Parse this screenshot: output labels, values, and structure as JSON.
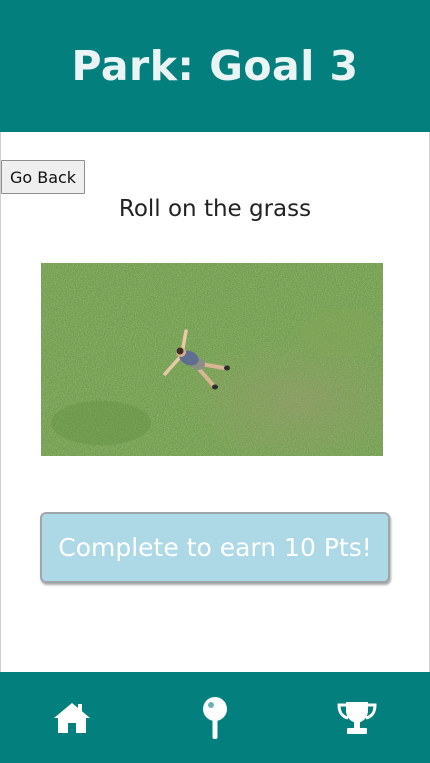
{
  "header": {
    "title": "Park: Goal 3"
  },
  "back_button": {
    "label": "Go Back"
  },
  "goal": {
    "description": "Roll on the grass",
    "image_icon": "grass-photo"
  },
  "complete_button": {
    "label": "Complete to earn 10 Pts!"
  },
  "nav": {
    "items": [
      {
        "icon": "home-icon"
      },
      {
        "icon": "map-pin-icon"
      },
      {
        "icon": "trophy-icon"
      }
    ]
  },
  "colors": {
    "header_bg": "#037f7e",
    "footer_bg": "#037f7e",
    "header_text": "#eaf4f4",
    "complete_button_bg": "#add8e6",
    "complete_button_text": "#ffffff"
  }
}
